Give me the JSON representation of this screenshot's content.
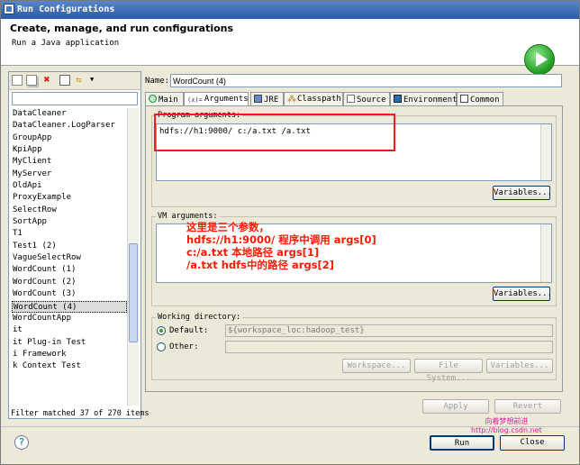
{
  "window": {
    "title": "Run Configurations"
  },
  "banner": {
    "title": "Create, manage, and run configurations",
    "subtitle": "Run a Java application"
  },
  "left_panel": {
    "filter_placeholder": "",
    "items": [
      {
        "label": "DataCleaner",
        "selected": false
      },
      {
        "label": "DataCleaner.LogParser",
        "selected": false
      },
      {
        "label": "GroupApp",
        "selected": false
      },
      {
        "label": "KpiApp",
        "selected": false
      },
      {
        "label": "MyClient",
        "selected": false
      },
      {
        "label": "MyServer",
        "selected": false
      },
      {
        "label": "OldApi",
        "selected": false
      },
      {
        "label": "ProxyExample",
        "selected": false
      },
      {
        "label": "SelectRow",
        "selected": false
      },
      {
        "label": "SortApp",
        "selected": false
      },
      {
        "label": "T1",
        "selected": false
      },
      {
        "label": "Test1 (2)",
        "selected": false
      },
      {
        "label": "VagueSelectRow",
        "selected": false
      },
      {
        "label": "WordCount (1)",
        "selected": false
      },
      {
        "label": "WordCount (2)",
        "selected": false
      },
      {
        "label": "WordCount (3)",
        "selected": false
      },
      {
        "label": "WordCount (4)",
        "selected": true
      },
      {
        "label": "WordCountApp",
        "selected": false
      },
      {
        "label": "it",
        "selected": false
      },
      {
        "label": "it Plug-in Test",
        "selected": false
      },
      {
        "label": "i Framework",
        "selected": false
      },
      {
        "label": "k Context Test",
        "selected": false
      }
    ],
    "filter_status": "Filter matched 37 of 270 items"
  },
  "name": {
    "label": "Name:",
    "value": "WordCount (4)"
  },
  "tabs": [
    {
      "label": "Main",
      "icon": "main-tab-icon",
      "active": false
    },
    {
      "label": "Arguments",
      "icon": "arguments-tab-icon",
      "active": true
    },
    {
      "label": "JRE",
      "icon": "jre-tab-icon",
      "active": false
    },
    {
      "label": "Classpath",
      "icon": "classpath-tab-icon",
      "active": false
    },
    {
      "label": "Source",
      "icon": "source-tab-icon",
      "active": false
    },
    {
      "label": "Environment",
      "icon": "environment-tab-icon",
      "active": false
    },
    {
      "label": "Common",
      "icon": "common-tab-icon",
      "active": false
    }
  ],
  "program_arguments": {
    "label": "Program arguments:",
    "value": "hdfs://h1:9000/ c:/a.txt /a.txt",
    "variables_label": "Variables..."
  },
  "vm_arguments": {
    "label": "VM arguments:",
    "value": "",
    "variables_label": "Variables..."
  },
  "annotation": {
    "lines": [
      "这里是三个参数，",
      "hdfs://h1:9000/ 程序中调用 args[0]",
      "c:/a.txt 本地路径 args[1]",
      "/a.txt hdfs中的路径 args[2]"
    ],
    "color": "#ff1a00"
  },
  "working_directory": {
    "label": "Working directory:",
    "default_label": "Default:",
    "default_value": "${workspace_loc:hadoop_test}",
    "other_label": "Other:",
    "other_value": "",
    "workspace_label": "Workspace...",
    "filesystem_label": "File System...",
    "variables_label": "Variables..."
  },
  "actions": {
    "apply": "Apply",
    "revert": "Revert",
    "run": "Run",
    "close": "Close"
  },
  "watermark": {
    "line1": "向着梦想前进",
    "line2": "http://blog.csdn.net"
  },
  "colors": {
    "title_bar": "#2a5aa8",
    "annotation": "#ff1a00",
    "highlight_box": "#e8201c",
    "run_icon": "#1e9a1e"
  }
}
